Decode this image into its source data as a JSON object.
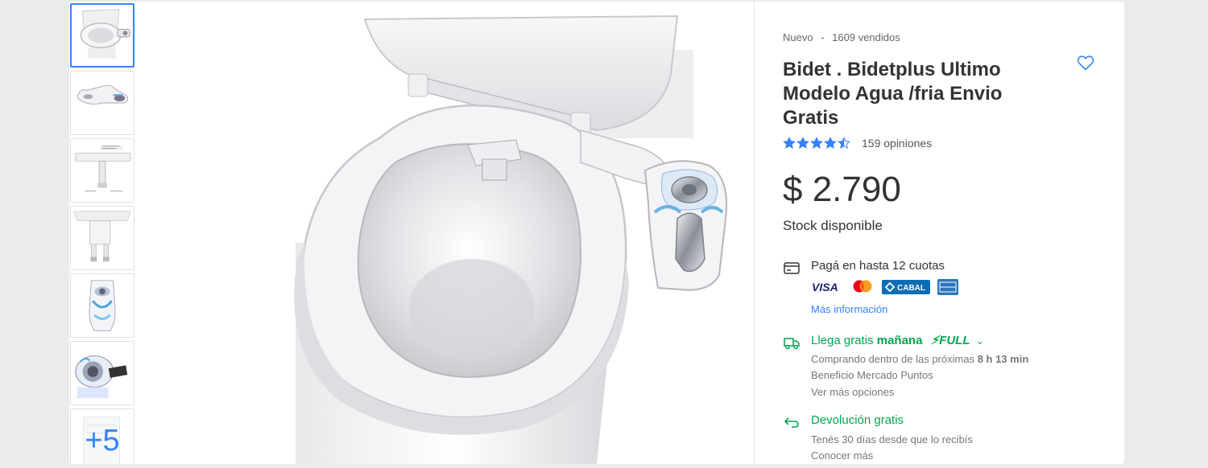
{
  "product": {
    "condition": "Nuevo",
    "separator": "-",
    "sold": "1609 vendidos",
    "title": "Bidet . Bidetplus Ultimo Modelo Agua /fria Envio Gratis",
    "rating": 4.5,
    "reviews": "159 opiniones",
    "price": "$ 2.790",
    "stock": "Stock disponible"
  },
  "gallery": {
    "more_label": "+5",
    "thumbnail_icons": [
      "toilet-with-bidet",
      "bidet-attachment",
      "bidet-diagram",
      "bidet-hoses",
      "bidet-installed-top-view",
      "bidet-knob-closeup",
      "bidet-box"
    ],
    "main_image_icon": "toilet-with-bidet-attachment"
  },
  "payment": {
    "title": "Pagá en hasta 12 cuotas",
    "card_icons": [
      "visa-logo",
      "mastercard-logo",
      "cabal-logo",
      "amex-logo"
    ],
    "visa": "VISA",
    "cabal": "CABAL",
    "more": "Más información"
  },
  "shipping": {
    "prefix": "Llega gratis",
    "day": "mañana",
    "full": "FULL",
    "condition_prefix": "Comprando dentro de las próximas",
    "time": "8 h 13 min",
    "benefit": "Beneficio Mercado Puntos",
    "more": "Ver más opciones"
  },
  "returns": {
    "title": "Devolución gratis",
    "subtitle": "Tenés 30 días desde que lo recibís",
    "more": "Conocer más"
  },
  "colors": {
    "accent": "#3483fa",
    "green": "#00a650",
    "background": "#ebebeb"
  }
}
